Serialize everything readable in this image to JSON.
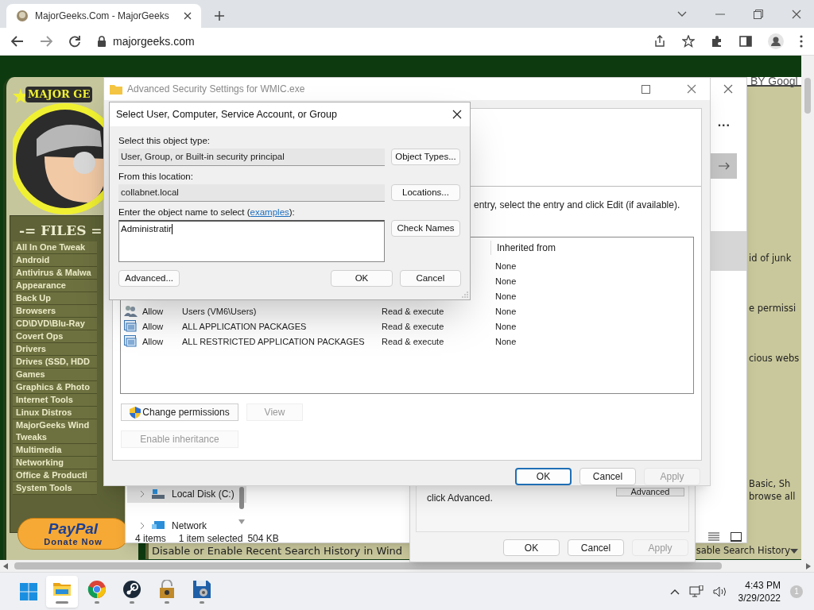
{
  "browser": {
    "tab_title": "MajorGeeks.Com - MajorGeeks",
    "url": "majorgeeks.com"
  },
  "page": {
    "logo_text": "MAJOR GE",
    "files_heading": "-= FILES =",
    "file_links": [
      "All In One Tweak",
      "Android",
      "Antivirus & Malwa",
      "Appearance",
      "Back Up",
      "Browsers",
      "CD\\DVD\\Blu-Ray",
      "Covert Ops",
      "Drivers",
      "Drives (SSD, HDD",
      "Games",
      "Graphics & Photo",
      "Internet Tools",
      "Linux Distros",
      "MajorGeeks Wind Tweaks",
      "Multimedia",
      "Networking",
      "Office & Producti",
      "System Tools"
    ],
    "paypal": {
      "brand": "PayPal",
      "action": "Donate Now"
    },
    "translate_text": "BY Googl",
    "snippets": [
      "id of junk",
      "e permissi",
      "cious webs",
      "Basic, Sh",
      "browse all"
    ],
    "bottom_links": [
      "Disable or Enable Recent Search History in Wind",
      "sable Search History"
    ]
  },
  "explorer": {
    "toolbar_more": "...",
    "nav": [
      {
        "label": "Local Disk (C:)",
        "kind": "drive",
        "selected": true
      },
      {
        "label": "Network",
        "kind": "network",
        "selected": false
      }
    ],
    "status": {
      "count": "4 items",
      "selection": "1 item selected",
      "size": "504 KB"
    }
  },
  "properties": {
    "text": "click Advanced.",
    "advanced_button": "Advanced",
    "buttons": [
      {
        "label": "OK",
        "disabled": false
      },
      {
        "label": "Cancel",
        "disabled": false
      },
      {
        "label": "Apply",
        "disabled": true
      }
    ]
  },
  "advanced_security": {
    "title": "Advanced Security Settings for WMIC.exe",
    "instruction": "entry, select the entry and click Edit (if available).",
    "column_header": "Inherited from",
    "rows": [
      {
        "inherited": "None"
      },
      {
        "inherited": "None"
      },
      {
        "inherited": "None"
      },
      {
        "kind": "user",
        "type": "Allow",
        "principal": "Users (VM6\\Users)",
        "access": "Read & execute",
        "inherited": "None"
      },
      {
        "kind": "package",
        "type": "Allow",
        "principal": "ALL APPLICATION PACKAGES",
        "access": "Read & execute",
        "inherited": "None"
      },
      {
        "kind": "package",
        "type": "Allow",
        "principal": "ALL RESTRICTED APPLICATION PACKAGES",
        "access": "Read & execute",
        "inherited": "None"
      }
    ],
    "actions": [
      {
        "label": "Change permissions",
        "kind": "elevated",
        "disabled": false
      },
      {
        "label": "View",
        "kind": "plain",
        "disabled": true
      },
      {
        "label": "Enable inheritance",
        "kind": "plain",
        "disabled": true
      }
    ],
    "buttons": [
      {
        "label": "OK",
        "default": true,
        "disabled": false
      },
      {
        "label": "Cancel",
        "default": false,
        "disabled": false
      },
      {
        "label": "Apply",
        "default": false,
        "disabled": true
      }
    ]
  },
  "select_dialog": {
    "title": "Select User, Computer, Service Account, or Group",
    "type_label": "Select this object type:",
    "type_value": "User, Group, or Built-in security principal",
    "type_button": "Object Types...",
    "location_label": "From this location:",
    "location_value": "collabnet.local",
    "location_button": "Locations...",
    "name_label": {
      "before": "Enter the object name to select (",
      "link": "examples",
      "after": "):"
    },
    "name_value": "Administratir",
    "check_button": "Check Names",
    "buttons": [
      {
        "label": "Advanced..."
      },
      {
        "label": "OK"
      },
      {
        "label": "Cancel"
      }
    ]
  },
  "taskbar": {
    "apps": [
      {
        "kind": "explorer",
        "active": true
      },
      {
        "kind": "browser",
        "active": false
      },
      {
        "kind": "game",
        "active": false
      },
      {
        "kind": "lock",
        "active": false
      },
      {
        "kind": "disk",
        "active": false
      }
    ],
    "time": "4:43 PM",
    "date": "3/29/2022",
    "notifications": "1"
  }
}
